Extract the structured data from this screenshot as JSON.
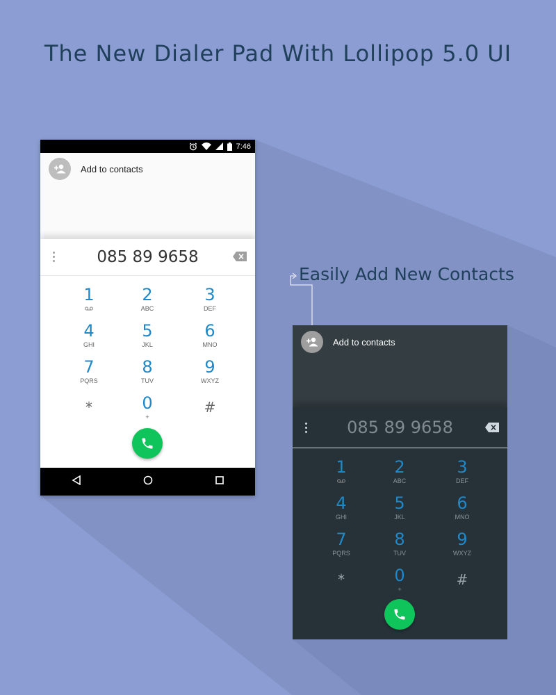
{
  "headline": "The New Dialer Pad With Lollipop 5.0 UI",
  "caption": "Easily Add New Contacts",
  "colors": {
    "background": "#8b9dd2",
    "headline": "#1f3f5a",
    "digit_accent": "#1e88c9",
    "call_button": "#0fc45a",
    "dark_pad": "#263238",
    "dark_top": "#343d42"
  },
  "status_bar": {
    "time": "7:46",
    "icons": [
      "alarm-icon",
      "wifi-icon",
      "signal-icon",
      "battery-icon"
    ]
  },
  "light_phone": {
    "contact_label": "Add to contacts",
    "number": "085 89 9658"
  },
  "dark_phone": {
    "contact_label": "Add to contacts",
    "number": "085 89 9658"
  },
  "keys": [
    {
      "digit": "1",
      "letters": "",
      "voicemail": true
    },
    {
      "digit": "2",
      "letters": "ABC"
    },
    {
      "digit": "3",
      "letters": "DEF"
    },
    {
      "digit": "4",
      "letters": "GHI"
    },
    {
      "digit": "5",
      "letters": "JKL"
    },
    {
      "digit": "6",
      "letters": "MNO"
    },
    {
      "digit": "7",
      "letters": "PQRS"
    },
    {
      "digit": "8",
      "letters": "TUV"
    },
    {
      "digit": "9",
      "letters": "WXYZ"
    },
    {
      "digit": "*",
      "letters": "",
      "symbol": true
    },
    {
      "digit": "0",
      "letters": "+"
    },
    {
      "digit": "#",
      "letters": "",
      "symbol": true
    }
  ],
  "nav_icons": [
    "back-icon",
    "home-icon",
    "recents-icon"
  ]
}
